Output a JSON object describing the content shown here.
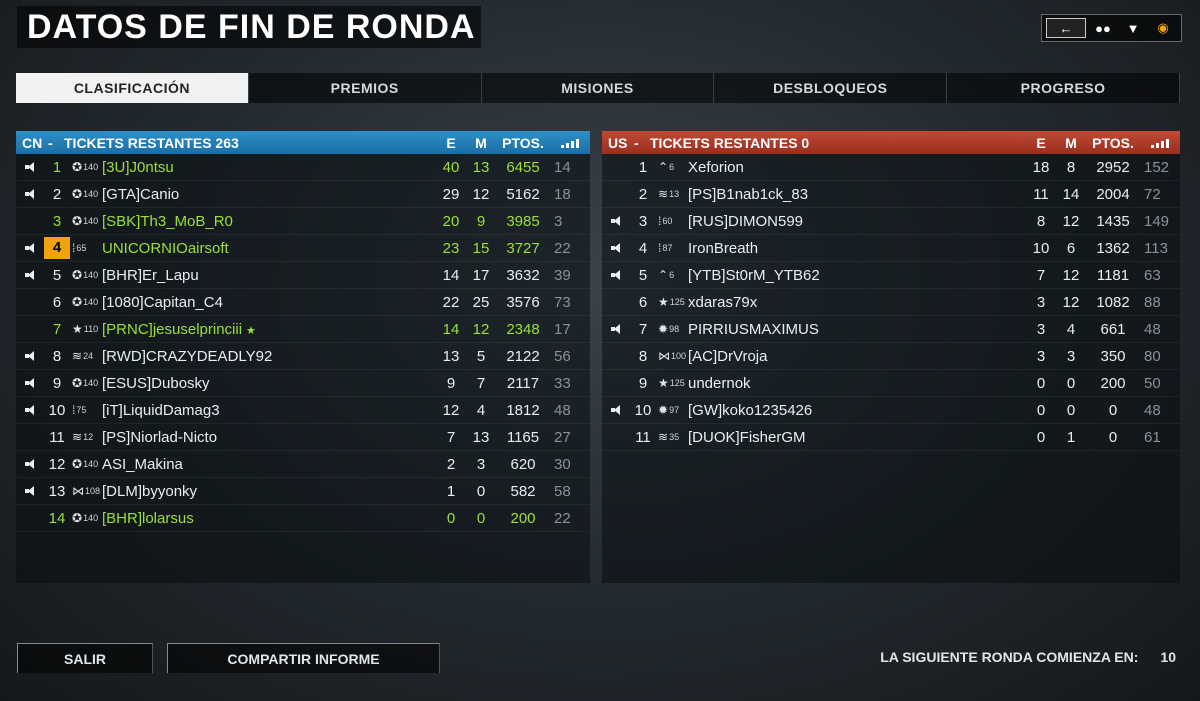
{
  "title": "DATOS DE FIN DE RONDA",
  "tabs": [
    "CLASIFICACIÓN",
    "PREMIOS",
    "MISIONES",
    "DESBLOQUEOS",
    "PROGRESO"
  ],
  "columns": {
    "kills": "E",
    "deaths": "M",
    "points": "PTOS."
  },
  "teams": {
    "left": {
      "tag": "CN",
      "tickets_label": "TICKETS RESTANTES 263",
      "players": [
        {
          "pos": "1",
          "rank": "140",
          "name": "[3U]J0ntsu",
          "k": "40",
          "d": "13",
          "pts": "6455",
          "ping": "14"
        },
        {
          "pos": "2",
          "rank": "140",
          "name": "[GTA]Canio",
          "k": "29",
          "d": "12",
          "pts": "5162",
          "ping": "18"
        },
        {
          "pos": "3",
          "rank": "140",
          "name": "[SBK]Th3_MoB_R0",
          "k": "20",
          "d": "9",
          "pts": "3985",
          "ping": "3"
        },
        {
          "pos": "4",
          "rank": "65",
          "name": "UNICORNIOairsoft",
          "k": "23",
          "d": "15",
          "pts": "3727",
          "ping": "22"
        },
        {
          "pos": "5",
          "rank": "140",
          "name": "[BHR]Er_Lapu",
          "k": "14",
          "d": "17",
          "pts": "3632",
          "ping": "39"
        },
        {
          "pos": "6",
          "rank": "140",
          "name": "[1080]Capitan_C4",
          "k": "22",
          "d": "25",
          "pts": "3576",
          "ping": "73"
        },
        {
          "pos": "7",
          "rank": "110",
          "name": "[PRNC]jesuselprinciii",
          "k": "14",
          "d": "12",
          "pts": "2348",
          "ping": "17"
        },
        {
          "pos": "8",
          "rank": "24",
          "name": "[RWD]CRAZYDEADLY92",
          "k": "13",
          "d": "5",
          "pts": "2122",
          "ping": "56"
        },
        {
          "pos": "9",
          "rank": "140",
          "name": "[ESUS]Dubosky",
          "k": "9",
          "d": "7",
          "pts": "2117",
          "ping": "33"
        },
        {
          "pos": "10",
          "rank": "75",
          "name": "[iT]LiquidDamag3",
          "k": "12",
          "d": "4",
          "pts": "1812",
          "ping": "48"
        },
        {
          "pos": "11",
          "rank": "12",
          "name": "[PS]Niorlad-Nicto",
          "k": "7",
          "d": "13",
          "pts": "1165",
          "ping": "27"
        },
        {
          "pos": "12",
          "rank": "140",
          "name": "ASI_Makina",
          "k": "2",
          "d": "3",
          "pts": "620",
          "ping": "30"
        },
        {
          "pos": "13",
          "rank": "108",
          "name": "[DLM]byyonky",
          "k": "1",
          "d": "0",
          "pts": "582",
          "ping": "58"
        },
        {
          "pos": "14",
          "rank": "140",
          "name": "[BHR]lolarsus",
          "k": "0",
          "d": "0",
          "pts": "200",
          "ping": "22"
        }
      ]
    },
    "right": {
      "tag": "US",
      "tickets_label": "TICKETS RESTANTES 0",
      "players": [
        {
          "pos": "1",
          "rank": "6",
          "name": "Xeforion",
          "k": "18",
          "d": "8",
          "pts": "2952",
          "ping": "152"
        },
        {
          "pos": "2",
          "rank": "13",
          "name": "[PS]B1nab1ck_83",
          "k": "11",
          "d": "14",
          "pts": "2004",
          "ping": "72"
        },
        {
          "pos": "3",
          "rank": "60",
          "name": "[RUS]DIMON599",
          "k": "8",
          "d": "12",
          "pts": "1435",
          "ping": "149"
        },
        {
          "pos": "4",
          "rank": "87",
          "name": "IronBreath",
          "k": "10",
          "d": "6",
          "pts": "1362",
          "ping": "113"
        },
        {
          "pos": "5",
          "rank": "6",
          "name": "[YTB]St0rM_YTB62",
          "k": "7",
          "d": "12",
          "pts": "1181",
          "ping": "63"
        },
        {
          "pos": "6",
          "rank": "125",
          "name": "xdaras79x",
          "k": "3",
          "d": "12",
          "pts": "1082",
          "ping": "88"
        },
        {
          "pos": "7",
          "rank": "98",
          "name": "PIRRIUSMAXIMUS",
          "k": "3",
          "d": "4",
          "pts": "661",
          "ping": "48"
        },
        {
          "pos": "8",
          "rank": "100",
          "name": "[AC]DrVroja",
          "k": "3",
          "d": "3",
          "pts": "350",
          "ping": "80"
        },
        {
          "pos": "9",
          "rank": "125",
          "name": "undernok",
          "k": "0",
          "d": "0",
          "pts": "200",
          "ping": "50"
        },
        {
          "pos": "10",
          "rank": "97",
          "name": "[GW]koko1235426",
          "k": "0",
          "d": "0",
          "pts": "0",
          "ping": "48"
        },
        {
          "pos": "11",
          "rank": "35",
          "name": "[DUOK]FisherGM",
          "k": "0",
          "d": "1",
          "pts": "0",
          "ping": "61"
        }
      ]
    }
  },
  "buttons": {
    "exit": "SALIR",
    "share": "COMPARTIR INFORME"
  },
  "countdown": {
    "label": "LA SIGUIENTE RONDA COMIENZA EN:",
    "value": "10"
  }
}
